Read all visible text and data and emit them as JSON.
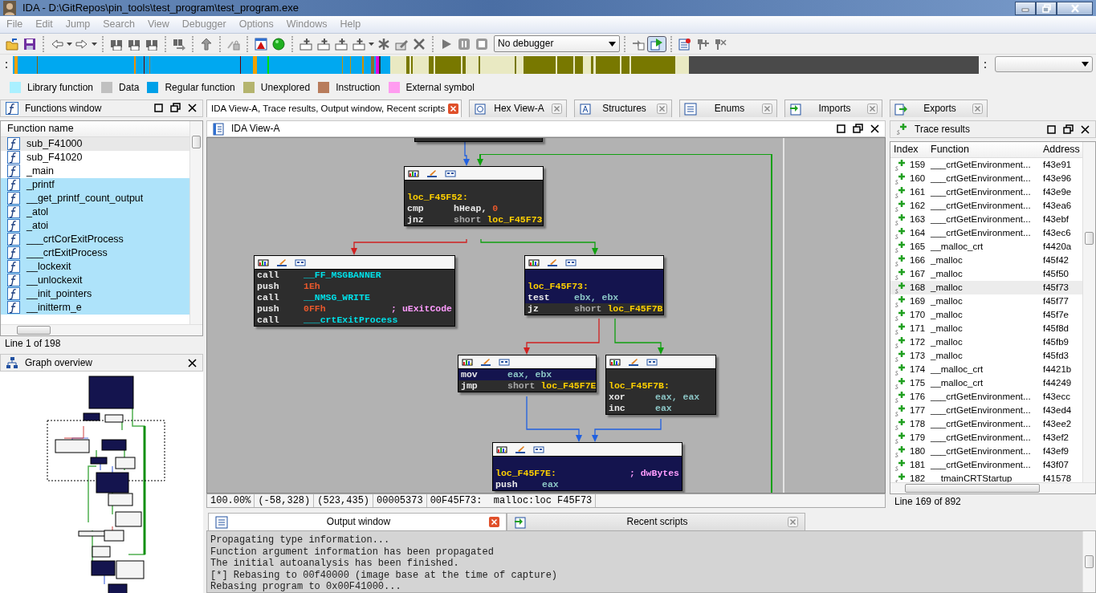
{
  "window": {
    "title": "IDA - D:\\GitRepos\\pin_tools\\test_program\\test_program.exe"
  },
  "menu": {
    "enabled": false,
    "items": [
      "File",
      "Edit",
      "Jump",
      "Search",
      "View",
      "Debugger",
      "Options",
      "Windows",
      "Help"
    ]
  },
  "toolbar": {
    "debugger": "No debugger"
  },
  "legend": [
    {
      "label": "Library function",
      "color": "#aaf0ff"
    },
    {
      "label": "Data",
      "color": "#c0c0c0"
    },
    {
      "label": "Regular function",
      "color": "#00a0e8"
    },
    {
      "label": "Unexplored",
      "color": "#b4b46e"
    },
    {
      "label": "Instruction",
      "color": "#b87c5c"
    },
    {
      "label": "External symbol",
      "color": "#ff9cf0"
    }
  ],
  "functions_window": {
    "title": "Functions window",
    "column": "Function name",
    "status": "Line 1 of 198",
    "rows": [
      {
        "name": "sub_F41000",
        "library": false,
        "selected": true
      },
      {
        "name": "sub_F41020",
        "library": false,
        "selected": false
      },
      {
        "name": "_main",
        "library": false,
        "selected": false
      },
      {
        "name": "_printf",
        "library": true,
        "selected": false
      },
      {
        "name": "__get_printf_count_output",
        "library": true,
        "selected": false
      },
      {
        "name": "_atol",
        "library": true,
        "selected": false
      },
      {
        "name": "_atoi",
        "library": true,
        "selected": false
      },
      {
        "name": "___crtCorExitProcess",
        "library": true,
        "selected": false
      },
      {
        "name": "___crtExitProcess",
        "library": true,
        "selected": false
      },
      {
        "name": "__lockexit",
        "library": true,
        "selected": false
      },
      {
        "name": "__unlockexit",
        "library": true,
        "selected": false
      },
      {
        "name": "__init_pointers",
        "library": true,
        "selected": false
      },
      {
        "name": "__initterm_e",
        "library": true,
        "selected": false
      }
    ]
  },
  "graph_overview": {
    "title": "Graph overview"
  },
  "tabs": [
    {
      "label": "IDA View-A, Trace results, Output window, Recent scripts",
      "selected": true
    },
    {
      "label": "Hex View-A",
      "selected": false
    },
    {
      "label": "Structures",
      "selected": false
    },
    {
      "label": "Enums",
      "selected": false
    },
    {
      "label": "Imports",
      "selected": false
    },
    {
      "label": "Exports",
      "selected": false
    }
  ],
  "ida_view": {
    "title": "IDA View-A",
    "graph": {
      "nodes": [
        {
          "lines": [
            {
              "kind": "blank",
              "highlighted": false
            },
            {
              "kind": "label",
              "text": "loc_F45F52:",
              "highlighted": false
            },
            {
              "kind": "insn",
              "mnemonic": "cmp",
              "operands": [
                {
                  "text": "hHeap",
                  "kind": "var"
                },
                {
                  "text": ", ",
                  "kind": "plain"
                },
                {
                  "text": "0",
                  "kind": "number"
                }
              ],
              "highlighted": false
            },
            {
              "kind": "insn",
              "mnemonic": "jnz",
              "operands": [
                {
                  "text": "short ",
                  "kind": "keyword"
                },
                {
                  "text": "loc_F45F73",
                  "kind": "label"
                }
              ],
              "highlighted": false
            }
          ]
        },
        {
          "lines": [
            {
              "kind": "insn",
              "mnemonic": "call",
              "operands": [
                {
                  "text": "__FF_MSGBANNER",
                  "kind": "name"
                }
              ],
              "highlighted": false
            },
            {
              "kind": "insn",
              "mnemonic": "push",
              "operands": [
                {
                  "text": "1Eh",
                  "kind": "number"
                }
              ],
              "highlighted": false
            },
            {
              "kind": "insn",
              "mnemonic": "call",
              "operands": [
                {
                  "text": "__NMSG_WRITE",
                  "kind": "name"
                }
              ],
              "highlighted": false
            },
            {
              "kind": "insn",
              "mnemonic": "push",
              "operands": [
                {
                  "text": "0FFh",
                  "kind": "number"
                }
              ],
              "comment": "; uExitCode",
              "highlighted": false
            },
            {
              "kind": "insn",
              "mnemonic": "call",
              "operands": [
                {
                  "text": "___crtExitProcess",
                  "kind": "name"
                }
              ],
              "highlighted": false
            }
          ]
        },
        {
          "lines": [
            {
              "kind": "blank",
              "highlighted": true
            },
            {
              "kind": "label",
              "text": "loc_F45F73:",
              "highlighted": true
            },
            {
              "kind": "insn",
              "mnemonic": "test",
              "operands": [
                {
                  "text": "ebx, ebx",
                  "kind": "register"
                }
              ],
              "highlighted": true
            },
            {
              "kind": "insn",
              "mnemonic": "jz",
              "operands": [
                {
                  "text": "short ",
                  "kind": "keyword"
                },
                {
                  "text": "loc_F45F7B",
                  "kind": "label"
                }
              ],
              "highlighted": false
            }
          ]
        },
        {
          "lines": [
            {
              "kind": "insn",
              "mnemonic": "mov",
              "operands": [
                {
                  "text": "eax, ebx",
                  "kind": "register"
                }
              ],
              "highlighted": true
            },
            {
              "kind": "insn",
              "mnemonic": "jmp",
              "operands": [
                {
                  "text": "short ",
                  "kind": "keyword"
                },
                {
                  "text": "loc_F45F7E",
                  "kind": "label"
                }
              ],
              "highlighted": false
            }
          ]
        },
        {
          "lines": [
            {
              "kind": "blank",
              "highlighted": false
            },
            {
              "kind": "label",
              "text": "loc_F45F7B:",
              "highlighted": false
            },
            {
              "kind": "insn",
              "mnemonic": "xor",
              "operands": [
                {
                  "text": "eax, eax",
                  "kind": "register"
                }
              ],
              "highlighted": false
            },
            {
              "kind": "insn",
              "mnemonic": "inc",
              "operands": [
                {
                  "text": "eax",
                  "kind": "register"
                }
              ],
              "highlighted": false
            }
          ]
        },
        {
          "lines": [
            {
              "kind": "blank",
              "highlighted": true
            },
            {
              "kind": "label",
              "text": "loc_F45F7E:",
              "comment": "; dwBytes",
              "highlighted": true
            },
            {
              "kind": "insn",
              "mnemonic": "push",
              "operands": [
                {
                  "text": "eax",
                  "kind": "register"
                }
              ],
              "highlighted": true
            }
          ]
        }
      ],
      "edges": [
        {
          "kind": "jump"
        },
        {
          "kind": "true"
        },
        {
          "kind": "false"
        },
        {
          "kind": "true"
        },
        {
          "kind": "false"
        },
        {
          "kind": "true"
        },
        {
          "kind": "jump"
        },
        {
          "kind": "jump"
        }
      ]
    },
    "status_bar": [
      "100.00%",
      "(-58,328)",
      "(523,435)",
      "00005373",
      "00F45F73:  malloc:loc F45F73"
    ]
  },
  "output": {
    "tabs": [
      {
        "label": "Output window",
        "selected": true
      },
      {
        "label": "Recent scripts",
        "selected": false
      }
    ],
    "lines": [
      "Propagating type information...",
      "Function argument information has been propagated",
      "The initial autoanalysis has been finished.",
      "[*] Rebasing to 00f40000 (image base at the time of capture)",
      "Rebasing program to 0x00F41000..."
    ]
  },
  "trace_results": {
    "title": "Trace results",
    "columns": [
      "Index",
      "Function",
      "Address"
    ],
    "status": "Line 169 of 892",
    "rows": [
      {
        "index": "159",
        "function": "___crtGetEnvironment...",
        "address": "f43e91",
        "selected": false
      },
      {
        "index": "160",
        "function": "___crtGetEnvironment...",
        "address": "f43e96",
        "selected": false
      },
      {
        "index": "161",
        "function": "___crtGetEnvironment...",
        "address": "f43e9e",
        "selected": false
      },
      {
        "index": "162",
        "function": "___crtGetEnvironment...",
        "address": "f43ea6",
        "selected": false
      },
      {
        "index": "163",
        "function": "___crtGetEnvironment...",
        "address": "f43ebf",
        "selected": false
      },
      {
        "index": "164",
        "function": "___crtGetEnvironment...",
        "address": "f43ec6",
        "selected": false
      },
      {
        "index": "165",
        "function": "__malloc_crt",
        "address": "f4420a",
        "selected": false
      },
      {
        "index": "166",
        "function": "_malloc",
        "address": "f45f42",
        "selected": false
      },
      {
        "index": "167",
        "function": "_malloc",
        "address": "f45f50",
        "selected": false
      },
      {
        "index": "168",
        "function": "_malloc",
        "address": "f45f73",
        "selected": true
      },
      {
        "index": "169",
        "function": "_malloc",
        "address": "f45f77",
        "selected": false
      },
      {
        "index": "170",
        "function": "_malloc",
        "address": "f45f7e",
        "selected": false
      },
      {
        "index": "171",
        "function": "_malloc",
        "address": "f45f8d",
        "selected": false
      },
      {
        "index": "172",
        "function": "_malloc",
        "address": "f45fb9",
        "selected": false
      },
      {
        "index": "173",
        "function": "_malloc",
        "address": "f45fd3",
        "selected": false
      },
      {
        "index": "174",
        "function": "__malloc_crt",
        "address": "f4421b",
        "selected": false
      },
      {
        "index": "175",
        "function": "__malloc_crt",
        "address": "f44249",
        "selected": false
      },
      {
        "index": "176",
        "function": "___crtGetEnvironment...",
        "address": "f43ecc",
        "selected": false
      },
      {
        "index": "177",
        "function": "___crtGetEnvironment...",
        "address": "f43ed4",
        "selected": false
      },
      {
        "index": "178",
        "function": "___crtGetEnvironment...",
        "address": "f43ee2",
        "selected": false
      },
      {
        "index": "179",
        "function": "___crtGetEnvironment...",
        "address": "f43ef2",
        "selected": false
      },
      {
        "index": "180",
        "function": "___crtGetEnvironment...",
        "address": "f43ef9",
        "selected": false
      },
      {
        "index": "181",
        "function": "___crtGetEnvironment...",
        "address": "f43f07",
        "selected": false
      },
      {
        "index": "182",
        "function": "__tmainCRTStartup",
        "address": "f41578",
        "selected": false
      }
    ]
  }
}
